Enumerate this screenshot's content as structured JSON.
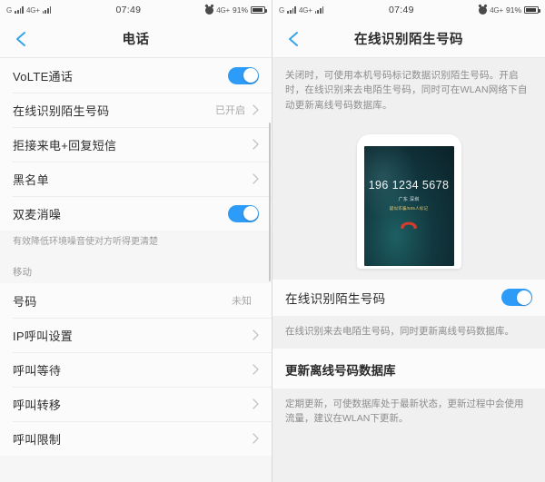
{
  "status_bar": {
    "carrier_glyph": "G",
    "network": "4G+",
    "time": "07:49",
    "network_right": "4G+",
    "battery_pct": "91%",
    "alarm_icon": "alarm-clock-icon"
  },
  "left_panel": {
    "nav": {
      "title": "电话",
      "back_icon": "back-chevron-icon"
    },
    "rows": [
      {
        "label": "VoLTE通话",
        "control": "toggle",
        "toggle_on": true
      },
      {
        "label": "在线识别陌生号码",
        "value": "已开启",
        "control": "chevron"
      },
      {
        "label": "拒接来电+回复短信",
        "control": "chevron"
      },
      {
        "label": "黑名单",
        "control": "chevron"
      },
      {
        "label": "双麦消噪",
        "control": "toggle",
        "toggle_on": true
      }
    ],
    "hint": "有效降低环境噪音使对方听得更清楚",
    "section_header": "移动",
    "rows2": [
      {
        "label": "号码",
        "value": "未知",
        "control": "none"
      },
      {
        "label": "IP呼叫设置",
        "control": "chevron"
      },
      {
        "label": "呼叫等待",
        "control": "chevron"
      },
      {
        "label": "呼叫转移",
        "control": "chevron"
      },
      {
        "label": "呼叫限制",
        "control": "chevron"
      }
    ]
  },
  "right_panel": {
    "nav": {
      "title": "在线识别陌生号码",
      "back_icon": "back-chevron-icon"
    },
    "description": "关闭时，可使用本机号码标记数据识别陌生号码。开启时，在线识别来去电陌生号码，同时可在WLAN网络下自动更新离线号码数据库。",
    "mockup": {
      "number": "196 1234 5678",
      "location": "广东 深圳",
      "tag": "疑似诈骗/505人标记",
      "hangup_icon": "hangup-handset-icon"
    },
    "toggle_row": {
      "label": "在线识别陌生号码",
      "toggle_on": true
    },
    "toggle_sub": "在线识别来去电陌生号码，同时更新离线号码数据库。",
    "section_title": "更新离线号码数据库",
    "section_sub": "定期更新，可使数据库处于最新状态，更新过程中会使用流量，建议在WLAN下更新。"
  },
  "colors": {
    "accent": "#2d9cf8",
    "back_arrow": "#37a3e8",
    "bg": "#f0f0f0",
    "card": "#fbfbfb",
    "hangup_red": "#d63b2e"
  }
}
